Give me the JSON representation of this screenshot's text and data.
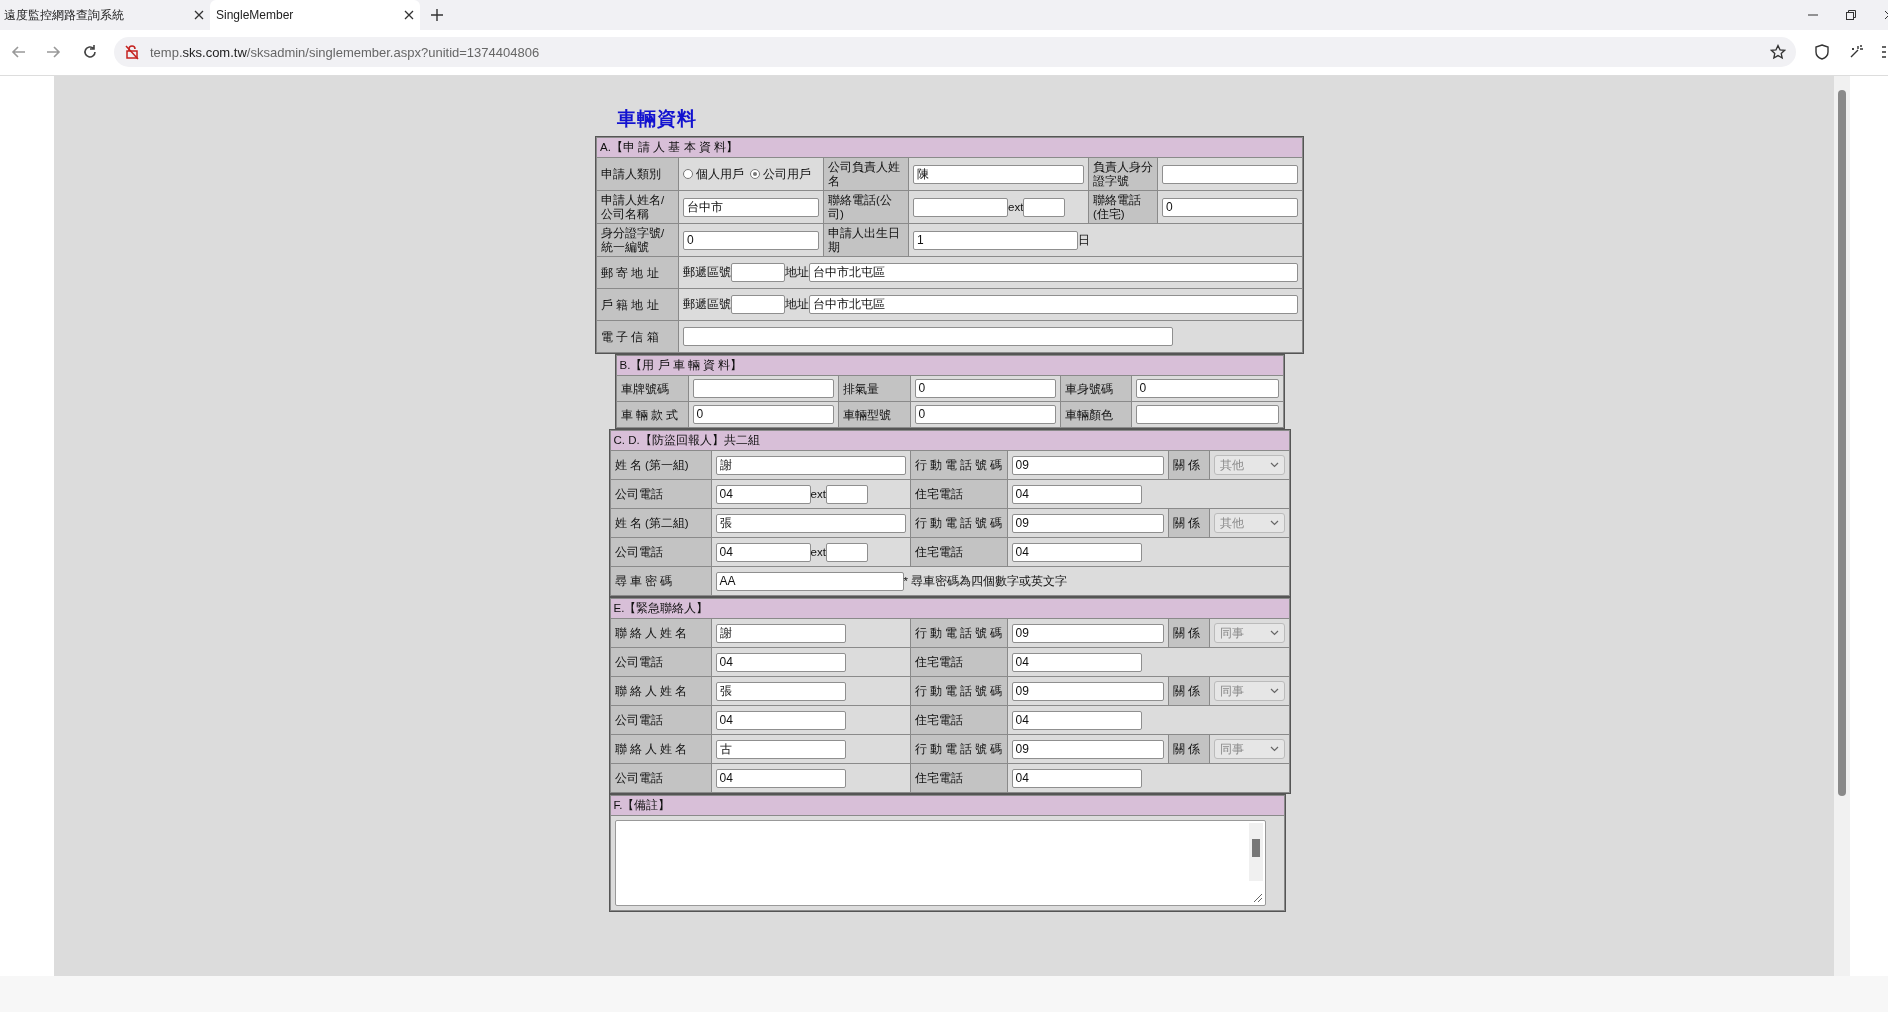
{
  "browser": {
    "tabs": [
      {
        "title": "遠度監控網路查詢系統",
        "selected": false
      },
      {
        "title": "SingleMember",
        "selected": true
      }
    ],
    "url": {
      "subdomain": "temp.",
      "domain": "sks.com.tw",
      "path": "/sksadmin/singlemember.aspx?unitid=1374404806"
    }
  },
  "page_title": "車輛資料",
  "sections": [
    {
      "title": "A.【申 請 人 基 本 資 料】",
      "rows": [
        {
          "cells": [
            {
              "kind": "label",
              "text": "申請人類別"
            },
            {
              "kind": "field",
              "items": [
                {
                  "kind": "radio",
                  "label": "個人用戶",
                  "selected": false
                },
                {
                  "kind": "radio",
                  "label": "公司用戶",
                  "selected": true
                }
              ]
            },
            {
              "kind": "label",
              "text": "公司負責人姓名"
            },
            {
              "kind": "field",
              "items": [
                {
                  "kind": "input",
                  "value": "陳"
                }
              ]
            },
            {
              "kind": "label",
              "text": "負責人身分證字號"
            },
            {
              "kind": "field",
              "items": [
                {
                  "kind": "input",
                  "value": ""
                }
              ]
            }
          ]
        },
        {
          "cells": [
            {
              "kind": "label",
              "text": "申請人姓名/公司名稱"
            },
            {
              "kind": "field",
              "items": [
                {
                  "kind": "input",
                  "value": "台中市"
                }
              ]
            },
            {
              "kind": "label",
              "text": "聯絡電話(公司)"
            },
            {
              "kind": "field",
              "items": [
                {
                  "kind": "phone-input",
                  "value": ""
                },
                {
                  "kind": "text",
                  "text": "ext"
                },
                {
                  "kind": "short-input",
                  "value": ""
                }
              ]
            },
            {
              "kind": "label",
              "text": "聯絡電話(住宅)"
            },
            {
              "kind": "field",
              "items": [
                {
                  "kind": "input",
                  "value": "0"
                }
              ]
            }
          ]
        },
        {
          "cells": [
            {
              "kind": "label",
              "text": "身分證字號/統一編號"
            },
            {
              "kind": "field",
              "items": [
                {
                  "kind": "input",
                  "value": "0"
                }
              ]
            },
            {
              "kind": "label",
              "text": "申請人出生日期"
            },
            {
              "kind": "field",
              "colspan": 3,
              "items": [
                {
                  "kind": "date-input",
                  "value": "1"
                },
                {
                  "kind": "text",
                  "text": "日"
                }
              ]
            }
          ]
        },
        {
          "cells": [
            {
              "kind": "label",
              "text": "郵 寄 地 址"
            },
            {
              "kind": "field",
              "colspan": 5,
              "items": [
                {
                  "kind": "text",
                  "text": "郵遞區號"
                },
                {
                  "kind": "zip-input",
                  "value": ""
                },
                {
                  "kind": "text",
                  "text": "地址"
                },
                {
                  "kind": "input",
                  "value": "台中市北屯區"
                }
              ]
            }
          ]
        },
        {
          "cells": [
            {
              "kind": "label",
              "text": "戶 籍 地 址"
            },
            {
              "kind": "field",
              "colspan": 5,
              "items": [
                {
                  "kind": "text",
                  "text": "郵遞區號"
                },
                {
                  "kind": "zip-input",
                  "value": ""
                },
                {
                  "kind": "text",
                  "text": "地址"
                },
                {
                  "kind": "input",
                  "value": "台中市北屯區"
                }
              ]
            }
          ]
        },
        {
          "cells": [
            {
              "kind": "label",
              "text": "電 子 信 箱"
            },
            {
              "kind": "field",
              "colspan": 5,
              "items": [
                {
                  "kind": "email-input",
                  "value": ""
                }
              ]
            }
          ]
        }
      ]
    },
    {
      "title": "B.【用 戶 車 輛 資 料】",
      "rows": [
        {
          "cells": [
            {
              "kind": "label",
              "text": "車牌號碼"
            },
            {
              "kind": "field",
              "items": [
                {
                  "kind": "input",
                  "value": ""
                }
              ]
            },
            {
              "kind": "label",
              "text": "排氣量"
            },
            {
              "kind": "field",
              "items": [
                {
                  "kind": "input",
                  "value": "0"
                }
              ]
            },
            {
              "kind": "label",
              "text": "車身號碼"
            },
            {
              "kind": "field",
              "items": [
                {
                  "kind": "input",
                  "value": "0"
                }
              ]
            }
          ]
        },
        {
          "cells": [
            {
              "kind": "label",
              "text": "車 輛 款 式"
            },
            {
              "kind": "field",
              "items": [
                {
                  "kind": "input",
                  "value": "0"
                }
              ]
            },
            {
              "kind": "label",
              "text": "車輛型號"
            },
            {
              "kind": "field",
              "items": [
                {
                  "kind": "input",
                  "value": "0"
                }
              ]
            },
            {
              "kind": "label",
              "text": "車輛顏色"
            },
            {
              "kind": "field",
              "items": [
                {
                  "kind": "input",
                  "value": ""
                }
              ]
            }
          ]
        }
      ]
    },
    {
      "title": "C. D.【防盜回報人】共二組",
      "rows": [
        {
          "cells": [
            {
              "kind": "label",
              "text": "姓 名 (第一組)"
            },
            {
              "kind": "field",
              "items": [
                {
                  "kind": "input",
                  "value": "謝"
                }
              ]
            },
            {
              "kind": "label",
              "text": "行 動 電 話 號 碼"
            },
            {
              "kind": "field",
              "items": [
                {
                  "kind": "input",
                  "value": "09"
                }
              ]
            },
            {
              "kind": "label",
              "text": "關 係"
            },
            {
              "kind": "field",
              "items": [
                {
                  "kind": "select",
                  "value": "其他",
                  "disabled": true
                }
              ]
            }
          ]
        },
        {
          "cells": [
            {
              "kind": "label",
              "text": "公司電話"
            },
            {
              "kind": "field",
              "items": [
                {
                  "kind": "phone-input",
                  "value": "04"
                },
                {
                  "kind": "text",
                  "text": "ext"
                },
                {
                  "kind": "short-input",
                  "value": ""
                }
              ]
            },
            {
              "kind": "label",
              "text": "住宅電話"
            },
            {
              "kind": "field",
              "colspan": 3,
              "items": [
                {
                  "kind": "medium-input",
                  "value": "04"
                }
              ]
            }
          ]
        },
        {
          "cells": [
            {
              "kind": "label",
              "text": "姓 名 (第二組)"
            },
            {
              "kind": "field",
              "items": [
                {
                  "kind": "input",
                  "value": "張"
                }
              ]
            },
            {
              "kind": "label",
              "text": "行 動 電 話 號 碼"
            },
            {
              "kind": "field",
              "items": [
                {
                  "kind": "input",
                  "value": "09"
                }
              ]
            },
            {
              "kind": "label",
              "text": "關 係"
            },
            {
              "kind": "field",
              "items": [
                {
                  "kind": "select",
                  "value": "其他",
                  "disabled": true
                }
              ]
            }
          ]
        },
        {
          "cells": [
            {
              "kind": "label",
              "text": "公司電話"
            },
            {
              "kind": "field",
              "items": [
                {
                  "kind": "phone-input",
                  "value": "04"
                },
                {
                  "kind": "text",
                  "text": "ext"
                },
                {
                  "kind": "short-input",
                  "value": ""
                }
              ]
            },
            {
              "kind": "label",
              "text": "住宅電話"
            },
            {
              "kind": "field",
              "colspan": 3,
              "items": [
                {
                  "kind": "medium-input",
                  "value": "04"
                }
              ]
            }
          ]
        },
        {
          "cells": [
            {
              "kind": "label",
              "text": "尋 車 密 碼"
            },
            {
              "kind": "field",
              "colspan": 5,
              "items": [
                {
                  "kind": "password-input",
                  "value": "AA"
                },
                {
                  "kind": "text",
                  "text": "* 尋車密碼為四個數字或英文字"
                }
              ]
            }
          ]
        }
      ]
    },
    {
      "title": "E.【緊急聯絡人】",
      "rows": [
        {
          "cells": [
            {
              "kind": "label",
              "text": "聯 絡 人 姓 名"
            },
            {
              "kind": "field",
              "items": [
                {
                  "kind": "medium-input",
                  "value": "謝"
                }
              ]
            },
            {
              "kind": "label",
              "text": "行 動 電 話 號 碼"
            },
            {
              "kind": "field",
              "items": [
                {
                  "kind": "input",
                  "value": "09"
                }
              ]
            },
            {
              "kind": "label",
              "text": "關 係"
            },
            {
              "kind": "field",
              "items": [
                {
                  "kind": "select",
                  "value": "同事",
                  "disabled": true
                }
              ]
            }
          ]
        },
        {
          "cells": [
            {
              "kind": "label",
              "text": "公司電話"
            },
            {
              "kind": "field",
              "items": [
                {
                  "kind": "medium-input",
                  "value": "04"
                }
              ]
            },
            {
              "kind": "label",
              "text": "住宅電話"
            },
            {
              "kind": "field",
              "colspan": 3,
              "items": [
                {
                  "kind": "medium-input",
                  "value": "04"
                }
              ]
            }
          ]
        },
        {
          "cells": [
            {
              "kind": "label",
              "text": "聯 絡 人 姓 名"
            },
            {
              "kind": "field",
              "items": [
                {
                  "kind": "medium-input",
                  "value": "張"
                }
              ]
            },
            {
              "kind": "label",
              "text": "行 動 電 話 號 碼"
            },
            {
              "kind": "field",
              "items": [
                {
                  "kind": "input",
                  "value": "09"
                }
              ]
            },
            {
              "kind": "label",
              "text": "關 係"
            },
            {
              "kind": "field",
              "items": [
                {
                  "kind": "select",
                  "value": "同事",
                  "disabled": true
                }
              ]
            }
          ]
        },
        {
          "cells": [
            {
              "kind": "label",
              "text": "公司電話"
            },
            {
              "kind": "field",
              "items": [
                {
                  "kind": "medium-input",
                  "value": "04"
                }
              ]
            },
            {
              "kind": "label",
              "text": "住宅電話"
            },
            {
              "kind": "field",
              "colspan": 3,
              "items": [
                {
                  "kind": "medium-input",
                  "value": "04"
                }
              ]
            }
          ]
        },
        {
          "cells": [
            {
              "kind": "label",
              "text": "聯 絡 人 姓 名"
            },
            {
              "kind": "field",
              "items": [
                {
                  "kind": "medium-input",
                  "value": "古"
                }
              ]
            },
            {
              "kind": "label",
              "text": "行 動 電 話 號 碼"
            },
            {
              "kind": "field",
              "items": [
                {
                  "kind": "input",
                  "value": "09"
                }
              ]
            },
            {
              "kind": "label",
              "text": "關 係"
            },
            {
              "kind": "field",
              "items": [
                {
                  "kind": "select",
                  "value": "同事",
                  "disabled": true
                }
              ]
            }
          ]
        },
        {
          "cells": [
            {
              "kind": "label",
              "text": "公司電話"
            },
            {
              "kind": "field",
              "items": [
                {
                  "kind": "medium-input",
                  "value": "04"
                }
              ]
            },
            {
              "kind": "label",
              "text": "住宅電話"
            },
            {
              "kind": "field",
              "colspan": 3,
              "items": [
                {
                  "kind": "medium-input",
                  "value": "04"
                }
              ]
            }
          ]
        }
      ]
    },
    {
      "title": "F.【備註】",
      "rows": [
        {
          "cells": [
            {
              "kind": "field",
              "items": [
                {
                  "kind": "textarea",
                  "value": ""
                }
              ]
            }
          ]
        }
      ]
    }
  ]
}
